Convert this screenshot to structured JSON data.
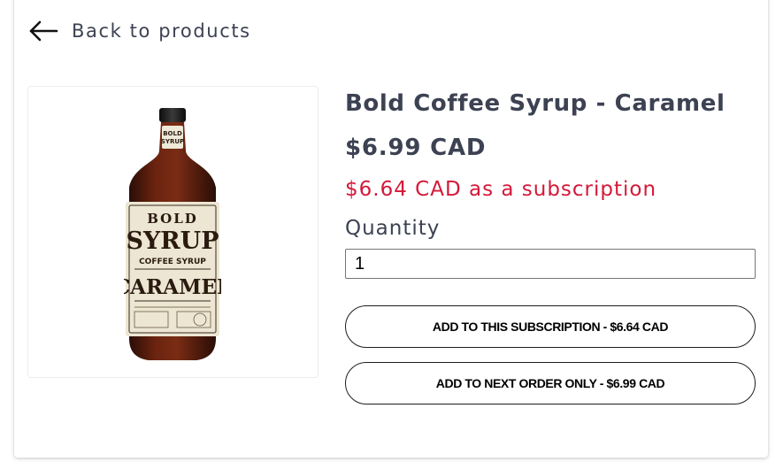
{
  "nav": {
    "back_label": "Back to products",
    "back_icon": "arrow-left-icon"
  },
  "product": {
    "title": "Bold Coffee Syrup - Caramel",
    "price": "$6.99 CAD",
    "subscription_price": "$6.64 CAD as a subscription",
    "image": {
      "label_top": "BOLD",
      "label_main": "SYRUP",
      "label_sub": "COFFEE SYRUP",
      "label_flavor": "CARAMEL",
      "neck_top": "BOLD",
      "neck_bottom": "SYRUP"
    }
  },
  "quantity": {
    "label": "Quantity",
    "value": "1"
  },
  "actions": {
    "add_to_subscription": "ADD TO THIS SUBSCRIPTION - $6.64 CAD",
    "add_to_next_order": "ADD TO NEXT ORDER ONLY - $6.99 CAD"
  },
  "colors": {
    "text": "#3c4252",
    "subscription_accent": "#d41839",
    "button_border": "#1e1e1e"
  }
}
